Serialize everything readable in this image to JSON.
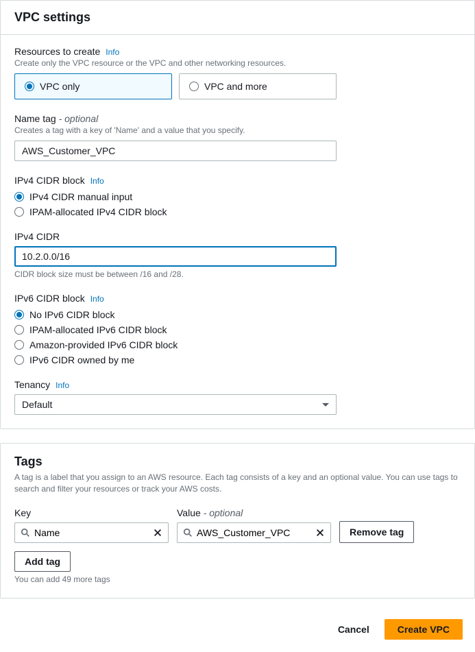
{
  "panel_title": "VPC settings",
  "resources": {
    "label": "Resources to create",
    "info": "Info",
    "hint": "Create only the VPC resource or the VPC and other networking resources.",
    "options": [
      "VPC only",
      "VPC and more"
    ],
    "selected": 0
  },
  "name_tag": {
    "label": "Name tag",
    "optional": "- optional",
    "hint": "Creates a tag with a key of 'Name' and a value that you specify.",
    "value": "AWS_Customer_VPC"
  },
  "ipv4_block": {
    "label": "IPv4 CIDR block",
    "info": "Info",
    "options": [
      "IPv4 CIDR manual input",
      "IPAM-allocated IPv4 CIDR block"
    ],
    "selected": 0
  },
  "ipv4_cidr": {
    "label": "IPv4 CIDR",
    "value": "10.2.0.0/16",
    "hint": "CIDR block size must be between /16 and /28."
  },
  "ipv6_block": {
    "label": "IPv6 CIDR block",
    "info": "Info",
    "options": [
      "No IPv6 CIDR block",
      "IPAM-allocated IPv6 CIDR block",
      "Amazon-provided IPv6 CIDR block",
      "IPv6 CIDR owned by me"
    ],
    "selected": 0
  },
  "tenancy": {
    "label": "Tenancy",
    "info": "Info",
    "value": "Default"
  },
  "tags": {
    "title": "Tags",
    "desc": "A tag is a label that you assign to an AWS resource. Each tag consists of a key and an optional value. You can use tags to search and filter your resources or track your AWS costs.",
    "key_label": "Key",
    "value_label": "Value",
    "value_optional": "- optional",
    "rows": [
      {
        "key": "Name",
        "value": "AWS_Customer_VPC"
      }
    ],
    "remove": "Remove tag",
    "add": "Add tag",
    "remaining": "You can add 49 more tags"
  },
  "footer": {
    "cancel": "Cancel",
    "submit": "Create VPC"
  }
}
